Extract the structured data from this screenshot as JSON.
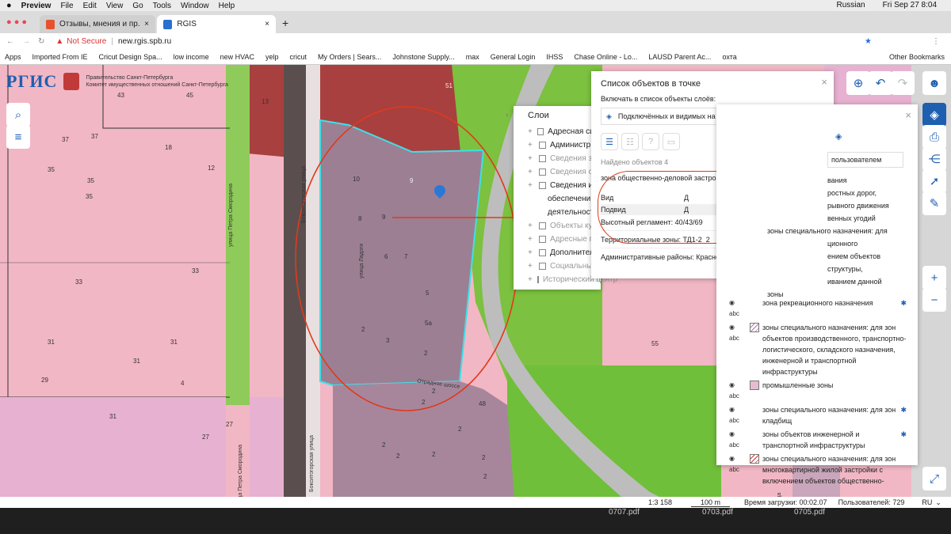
{
  "macmenu": {
    "app": "Preview",
    "items": [
      "File",
      "Edit",
      "View",
      "Go",
      "Tools",
      "Window",
      "Help"
    ],
    "lang": "Russian",
    "datetime": "Fri Sep 27  8:04"
  },
  "tabs": [
    {
      "label": "Отзывы, мнения и пр. о ЖК «..."
    },
    {
      "label": "RGIS"
    }
  ],
  "address": {
    "warning": "Not Secure",
    "url": "new.rgis.spb.ru"
  },
  "bookmarks": [
    "Apps",
    "Imported From IE",
    "Cricut Design Spa...",
    "low income",
    "new HVAC",
    "yelp",
    "cricut",
    "My Orders | Sears...",
    "Johnstone Supply...",
    "max",
    "General Login",
    "IHSS",
    "Chase Online - Lo...",
    "LAUSD Parent Ac...",
    "охта",
    "Other Bookmarks"
  ],
  "header": {
    "logo": "РГИС",
    "gov_line1": "Правительство Санкт-Петербурга",
    "gov_line2": "Комитет имущественных отношений Санкт-Петербурга"
  },
  "layers": {
    "title": "Слои",
    "items": [
      "Адресная си...",
      "Администр...",
      "Сведения з...",
      "Сведения о...",
      "Сведения и...",
      "обеспечени...",
      "деятельност...",
      "Объекты ку...",
      "Адресные п...",
      "Дополнител...",
      "Социальны...",
      "Исторический центр"
    ]
  },
  "objects": {
    "title": "Список объектов в точке",
    "include_label": "Включать в список объекты слоёв:",
    "layers_select": "Подключённых и видимых на карте",
    "found": "Найдено объектов 4",
    "zone_title": "зона общественно-деловой застройки: Д",
    "rows": [
      {
        "k": "Вид",
        "v": "Д"
      },
      {
        "k": "Подвид",
        "v": "Д"
      }
    ],
    "sections": [
      "Высотный регламент: 40/43/69",
      "Территориальные зоны: ТД1-2_2",
      "Административные районы: Красногвардейский"
    ]
  },
  "legend": {
    "user_label": "пользователем",
    "items": [
      "вания",
      "ростных дорог,",
      "рывного движения",
      "венных угодий",
      "зоны специального назначения: для",
      "ционного",
      "ением объектов",
      "структуры,",
      "иванием данной",
      "зоны",
      "зона рекреационного назначения",
      "зоны специального назначения: для зон объектов производственного, транспортно-логистического, складского назначения, инженерной и транспортной инфраструктуры",
      "промышленные зоны",
      "зоны специального назначения: для зон кладбищ",
      "зоны объектов инженерной и транспортной инфраструктуры",
      "зоны специального назначения: для зон многоквартирной жилой застройки с включением объектов общественно-"
    ]
  },
  "streets": [
    "Бокситогорская улица",
    "улица Петра Смородина",
    "улица Ладоги",
    "Отрадное шоссе",
    "улица Петра Смородина",
    "Бокситогорская улица",
    "улица"
  ],
  "parcels": [
    "43",
    "45",
    "51",
    "13",
    "37",
    "37",
    "35",
    "18",
    "35",
    "12",
    "35",
    "33",
    "33",
    "31",
    "31",
    "31",
    "29",
    "4",
    "31",
    "27",
    "27",
    "10",
    "9",
    "8",
    "9",
    "6",
    "7",
    "5",
    "2",
    "3",
    "5а",
    "2",
    "55",
    "48",
    "2",
    "2",
    "2",
    "2",
    "2",
    "2",
    "2",
    "2"
  ],
  "status": {
    "scale": "1:3 158",
    "scalebar": "100 m",
    "load": "Время загрузки: 00:02.07",
    "users": "Пользователей: 729",
    "lang": "RU"
  },
  "dock": [
    "0707.pdf",
    "0703.pdf",
    "0705.pdf"
  ],
  "colors": {
    "zone_business": "#9c7e93",
    "zone_recreation": "#6fbf3a",
    "zone_residential": "#f3b6c3",
    "zone_special": "#e9b3d4",
    "annotation": "#e03a1a"
  }
}
